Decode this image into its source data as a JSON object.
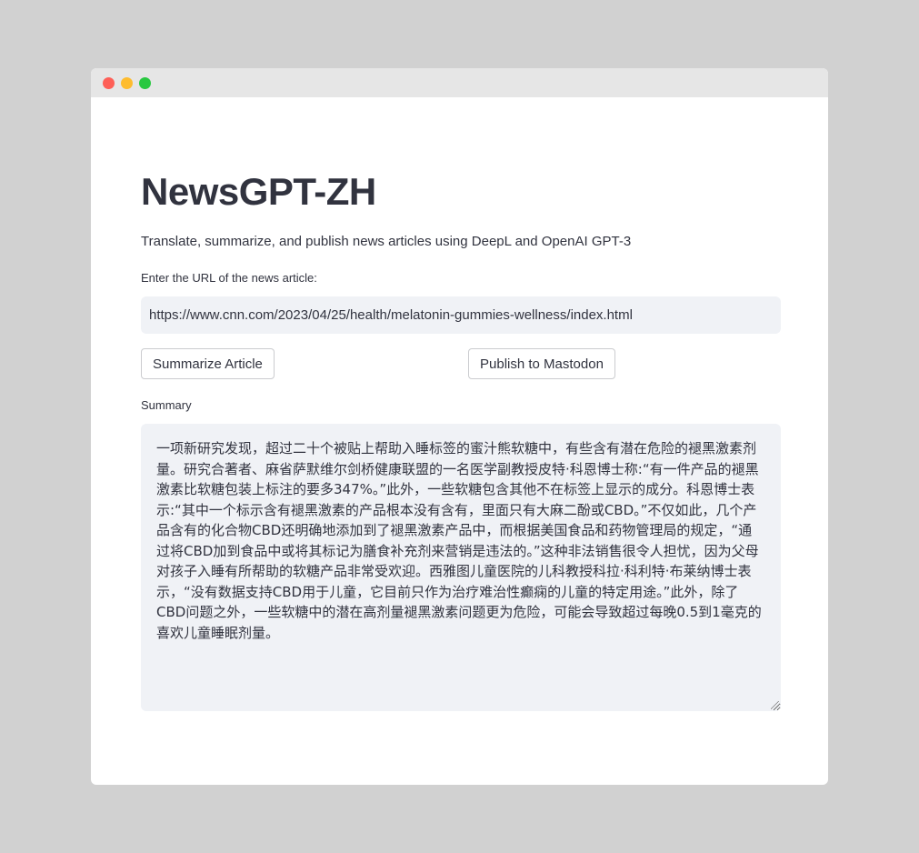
{
  "window": {
    "controls": [
      "close",
      "minimize",
      "maximize"
    ]
  },
  "app": {
    "title": "NewsGPT-ZH",
    "subtitle": "Translate, summarize, and publish news articles using DeepL and OpenAI GPT-3"
  },
  "url_field": {
    "label": "Enter the URL of the news article:",
    "value": "https://www.cnn.com/2023/04/25/health/melatonin-gummies-wellness/index.html"
  },
  "buttons": {
    "summarize": "Summarize Article",
    "publish": "Publish to Mastodon"
  },
  "summary": {
    "label": "Summary",
    "text": "一项新研究发现，超过二十个被贴上帮助入睡标签的蜜汁熊软糖中，有些含有潜在危险的褪黑激素剂量。研究合著者、麻省萨默维尔剑桥健康联盟的一名医学副教授皮特·科恩博士称:“有一件产品的褪黑激素比软糖包装上标注的要多347%。”此外，一些软糖包含其他不在标签上显示的成分。科恩博士表示:“其中一个标示含有褪黑激素的产品根本没有含有，里面只有大麻二酚或CBD。”不仅如此，几个产品含有的化合物CBD还明确地添加到了褪黑激素产品中，而根据美国食品和药物管理局的规定，“通过将CBD加到食品中或将其标记为膳食补充剂来营销是违法的。”这种非法销售很令人担忧，因为父母对孩子入睡有所帮助的软糖产品非常受欢迎。西雅图儿童医院的儿科教授科拉·科利特·布莱纳博士表示，“没有数据支持CBD用于儿童，它目前只作为治疗难治性癫痫的儿童的特定用途。”此外，除了CBD问题之外，一些软糖中的潜在高剂量褪黑激素问题更为危险，可能会导致超过每晚0.5到1毫克的喜欢儿童睡眠剂量。"
  }
}
